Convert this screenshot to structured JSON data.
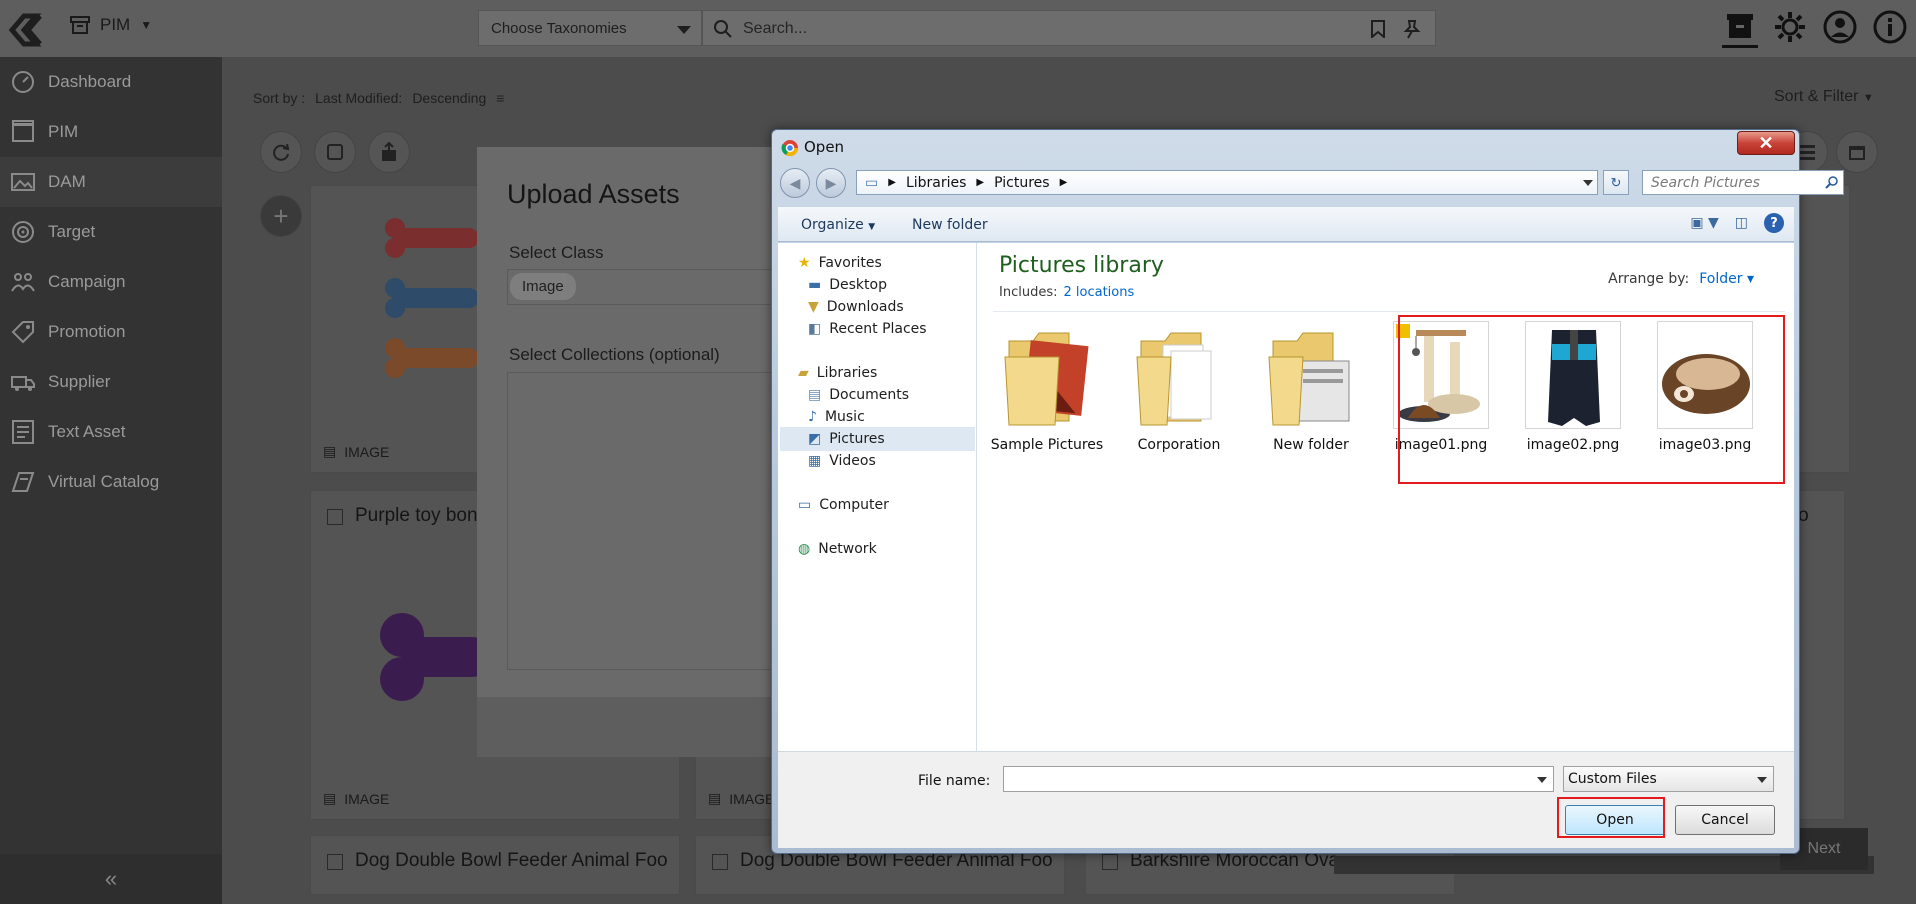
{
  "topbar": {
    "app_menu_label": "PIM",
    "taxonomy_select": "Choose Taxonomies",
    "search_placeholder": "Search..."
  },
  "sidebar": {
    "items": [
      {
        "label": "Dashboard",
        "icon": "dashboard-icon"
      },
      {
        "label": "PIM",
        "icon": "pim-icon"
      },
      {
        "label": "DAM",
        "icon": "dam-icon"
      },
      {
        "label": "Target",
        "icon": "target-icon"
      },
      {
        "label": "Campaign",
        "icon": "campaign-icon"
      },
      {
        "label": "Promotion",
        "icon": "promotion-icon"
      },
      {
        "label": "Supplier",
        "icon": "supplier-icon"
      },
      {
        "label": "Text Asset",
        "icon": "text-asset-icon"
      },
      {
        "label": "Virtual Catalog",
        "icon": "virtual-catalog-icon"
      }
    ],
    "collapse_glyph": "«"
  },
  "main": {
    "sort_by_label": "Sort by :",
    "sort_field": "Last Modified:",
    "sort_direction": "Descending",
    "sort_filter_label": "Sort & Filter",
    "cards": [
      {
        "title": "",
        "tag": "IMAGE"
      },
      {
        "title": "Purple toy bon",
        "tag": "IMAGE"
      },
      {
        "title": "",
        "tag": "IMAGE"
      },
      {
        "title": "Dog Double Bowl Feeder Animal Foo",
        "tag": ""
      },
      {
        "title": "Dog Double Bowl Feeder Animal Foo",
        "tag": ""
      },
      {
        "title": "Barkshire Moroccan Ova",
        "tag": ""
      },
      {
        "title": "Foo",
        "tag": ""
      }
    ],
    "next_label": "Next"
  },
  "upload_modal": {
    "title": "Upload Assets",
    "select_class_label": "Select Class",
    "class_value": "Image",
    "select_collections_label": "Select Collections (optional)"
  },
  "open_dialog": {
    "title": "Open",
    "breadcrumb": [
      "Libraries",
      "Pictures"
    ],
    "search_placeholder": "Search Pictures",
    "organize_label": "Organize",
    "new_folder_label": "New folder",
    "nav": {
      "favorites": "Favorites",
      "favorites_items": [
        "Desktop",
        "Downloads",
        "Recent Places"
      ],
      "libraries": "Libraries",
      "libraries_items": [
        "Documents",
        "Music",
        "Pictures",
        "Videos"
      ],
      "selected": "Pictures",
      "computer": "Computer",
      "network": "Network"
    },
    "library_title": "Pictures library",
    "includes_label": "Includes:",
    "includes_link": "2 locations",
    "arrange_label": "Arrange by:",
    "arrange_value": "Folder",
    "items": [
      {
        "name": "Sample Pictures",
        "kind": "folder"
      },
      {
        "name": "Corporation",
        "kind": "folder"
      },
      {
        "name": "New folder",
        "kind": "folder"
      },
      {
        "name": "image01.png",
        "kind": "image"
      },
      {
        "name": "image02.png",
        "kind": "image"
      },
      {
        "name": "image03.png",
        "kind": "image"
      }
    ],
    "file_name_label": "File name:",
    "file_name_value": "",
    "file_type": "Custom Files",
    "open_label": "Open",
    "cancel_label": "Cancel"
  }
}
